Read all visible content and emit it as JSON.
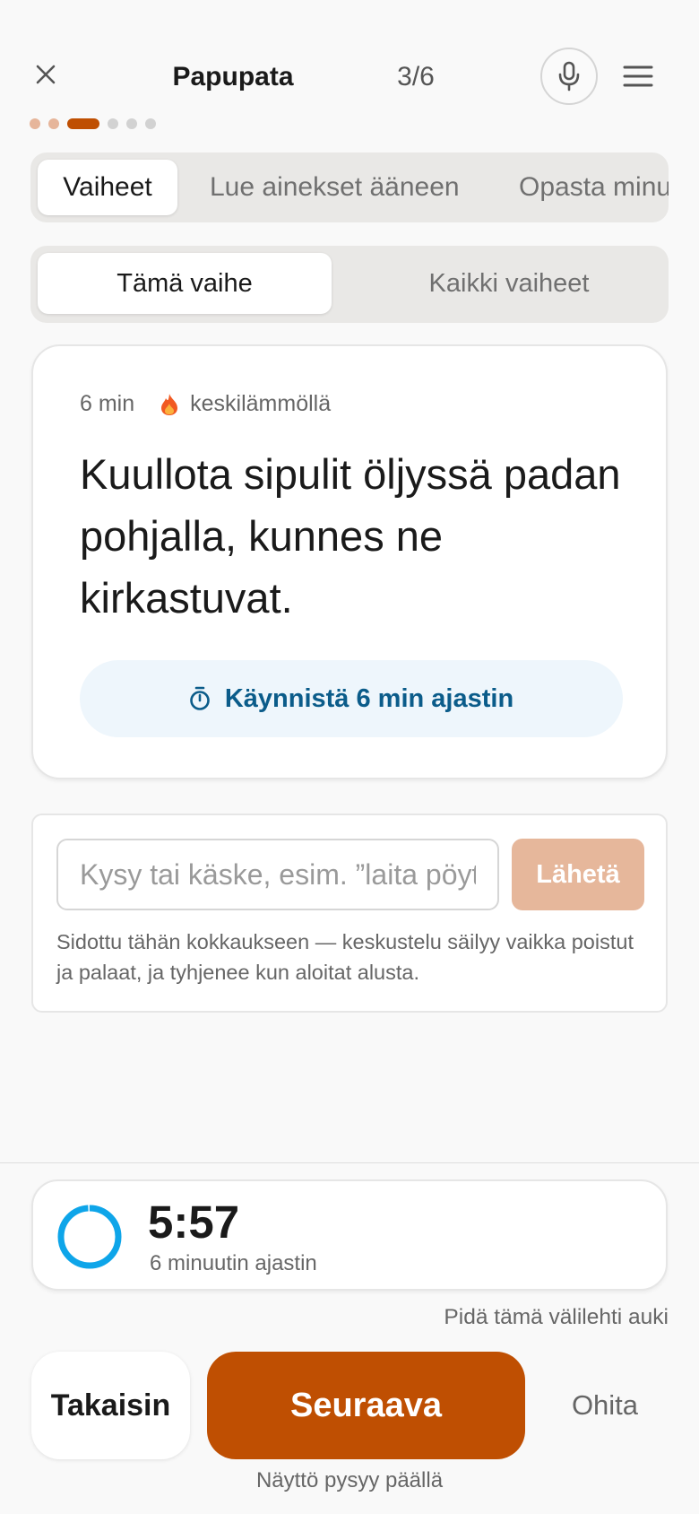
{
  "header": {
    "title": "Papupata",
    "counter": "3/6"
  },
  "progress": {
    "current": 3,
    "total": 6
  },
  "tabs": [
    {
      "label": "Vaiheet",
      "active": true
    },
    {
      "label": "Lue ainekset ääneen",
      "active": false
    },
    {
      "label": "Opasta minua",
      "active": false
    }
  ],
  "segment": {
    "this_step": "Tämä vaihe",
    "all_steps": "Kaikki vaiheet"
  },
  "step": {
    "duration": "6 min",
    "heat": "keskilämmöllä",
    "instruction": "Kuullota sipulit öljyssä padan pohjalla, kunnes ne kirkastuvat.",
    "timer_button": "Käynnistä 6 min ajastin"
  },
  "chat": {
    "placeholder": "Kysy tai käske, esim. ”laita pöytään”",
    "send_label": "Lähetä",
    "hint": "Sidottu tähän kokkaukseen — keskustelu säilyy vaikka poistut ja palaat, ja tyhjenee kun aloitat alusta."
  },
  "timer": {
    "time": "5:57",
    "label": "6 minuutin ajastin",
    "remaining_fraction": 0.99
  },
  "notices": {
    "keep_tab": "Pidä tämä välilehti auki",
    "screen_on": "Näyttö pysyy päällä"
  },
  "nav": {
    "back": "Takaisin",
    "next": "Seuraava",
    "skip": "Ohita"
  },
  "colors": {
    "accent": "#bf4f02",
    "accent_light": "#e6b79b",
    "timer_ring": "#0ea5e9",
    "timer_button_text": "#0b5c8a"
  }
}
